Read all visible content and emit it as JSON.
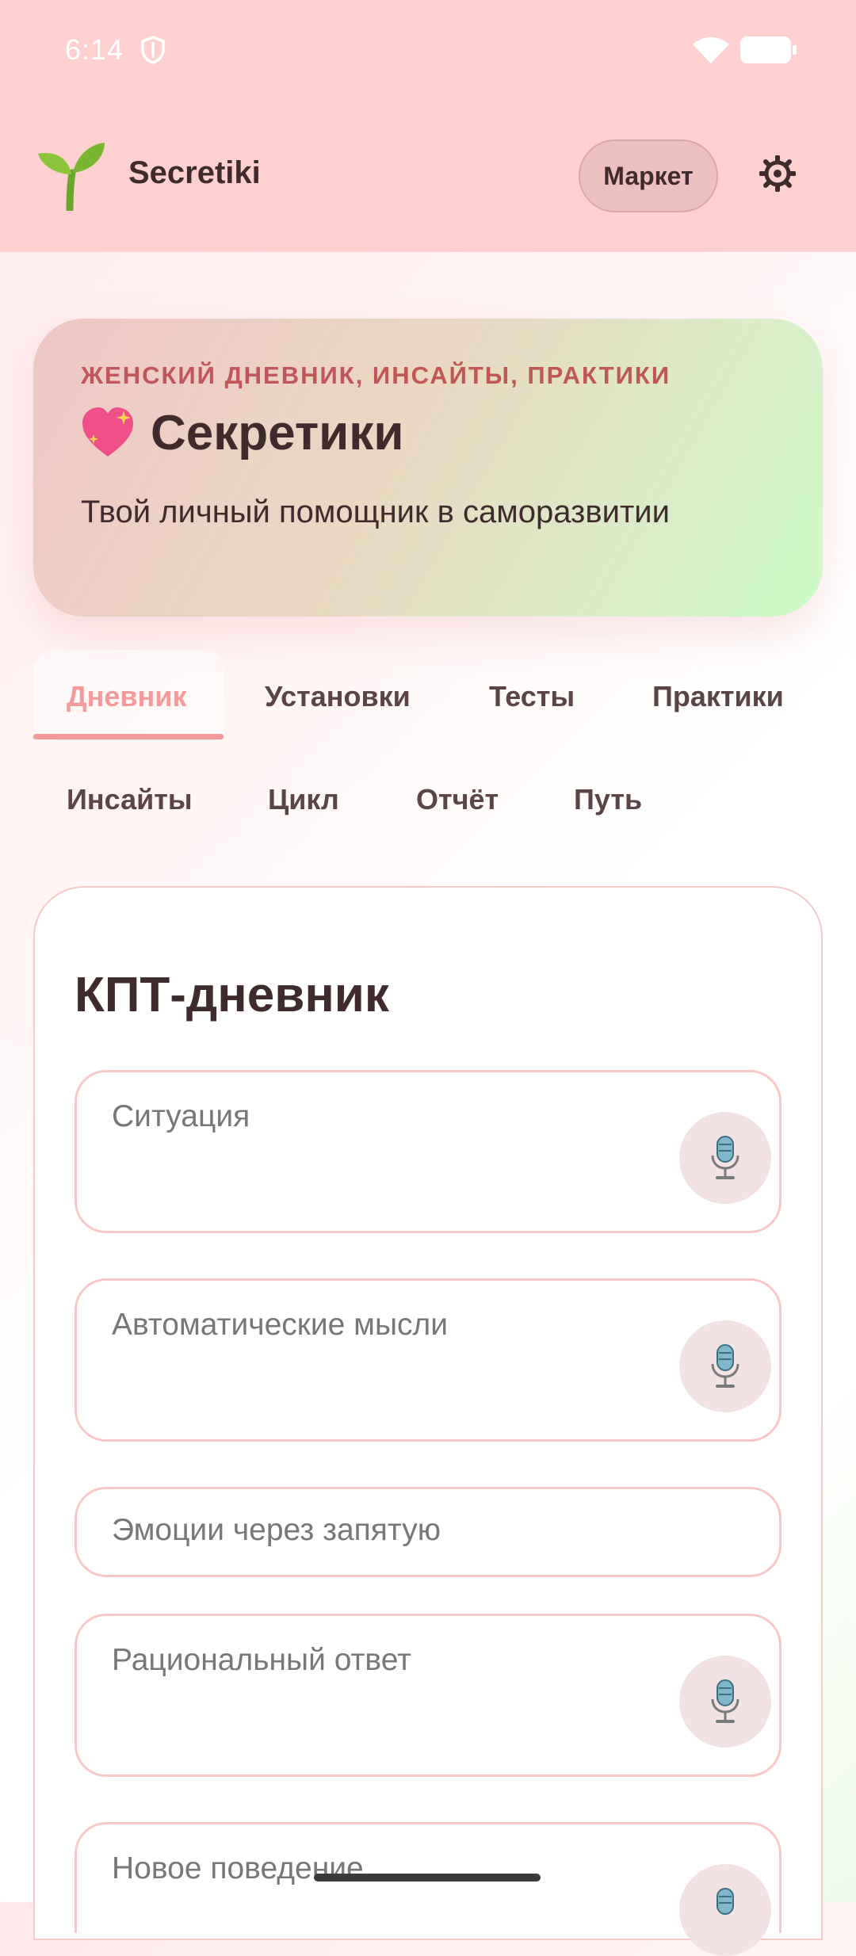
{
  "status_bar": {
    "time": "6:14"
  },
  "header": {
    "app_title": "Secretiki",
    "market_label": "Маркет"
  },
  "hero": {
    "kicker": "ЖЕНСКИЙ ДНЕВНИК, ИНСАЙТЫ, ПРАКТИКИ",
    "title": "Секретики",
    "subtitle": "Твой личный помощник в саморазвитии"
  },
  "tabs": [
    {
      "label": "Дневник",
      "active": true
    },
    {
      "label": "Установки"
    },
    {
      "label": "Тесты"
    },
    {
      "label": "Практики"
    },
    {
      "label": "Инсайты"
    },
    {
      "label": "Цикл"
    },
    {
      "label": "Отчёт"
    },
    {
      "label": "Путь"
    }
  ],
  "form": {
    "title": "КПТ-дневник",
    "fields": [
      {
        "placeholder": "Ситуация",
        "mic": true
      },
      {
        "placeholder": "Автоматические мысли",
        "mic": true
      },
      {
        "placeholder": "Эмоции через запятую",
        "mic": false
      },
      {
        "placeholder": "Рациональный ответ",
        "mic": true
      },
      {
        "placeholder": "Новое поведение",
        "mic": true
      }
    ]
  },
  "colors": {
    "header_bg": "#ffd0d0",
    "accent": "#f59a9a",
    "kicker": "#c0565a"
  },
  "icons": [
    "shield-icon",
    "wifi-icon",
    "battery-icon",
    "sprout-logo-icon",
    "gear-icon",
    "sparkling-heart-icon",
    "microphone-icon"
  ]
}
